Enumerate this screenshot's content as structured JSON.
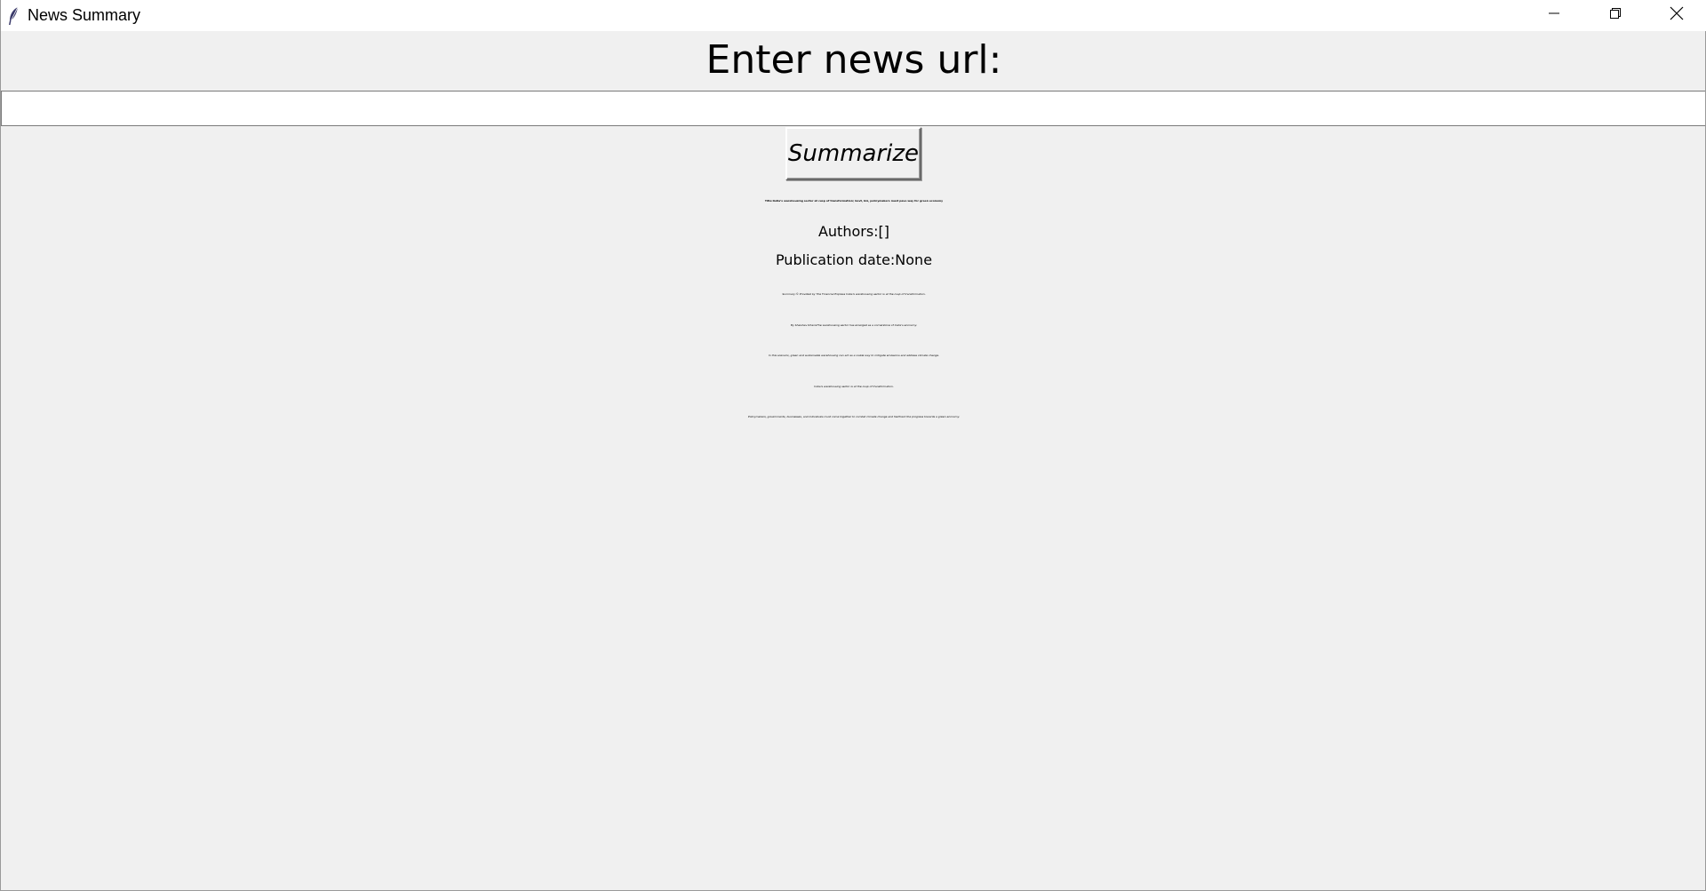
{
  "window": {
    "title": "News Summary",
    "icon": "feather-icon",
    "controls": [
      "minimize-icon",
      "restore-icon",
      "close-icon"
    ]
  },
  "form": {
    "heading": "Enter news url:",
    "url_value": "",
    "button_label": "Summarize"
  },
  "result": {
    "title": "Title:India’s warehousing sector at cusp of transformation; Govt, biz, policymakers must pave way for green economy",
    "authors": "Authors:[]",
    "publication_date": "Publication date:None",
    "summary_lines": [
      "Summary:© Provided by The Financial Express India’s warehousing sector is at the cusp of transformation.",
      "By Shaishav DhariaThe warehousing sector has emerged as a cornerstone of India’s economy.",
      "In this scenario, green and sustainable warehousing can act as a viable way to mitigate emissions and address climate change.",
      "India’s warehousing sector is at the cusp of transformation.",
      "Policymakers, governments, businesses, and individuals must come together to combat climate change and fasttrack the progress towards a green economy."
    ]
  }
}
